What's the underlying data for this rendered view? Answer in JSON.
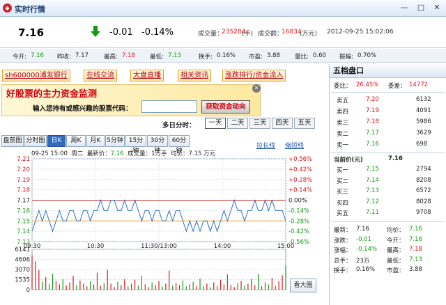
{
  "window": {
    "title": "实时行情",
    "minimize": "—",
    "maximize": "□",
    "close": "✕"
  },
  "quote": {
    "price": "7.16",
    "change": "-0.01",
    "change_pct": "-0.14%",
    "volume_label": "成交量：",
    "volume": "235284",
    "volume_unit": "(手)",
    "amount_label": "成交额：",
    "amount": "16834",
    "amount_unit": "(万元)",
    "datetime": "2012-09-25 15:02:06"
  },
  "stats": [
    {
      "label": "今开:",
      "value": "7.16",
      "color": "green"
    },
    {
      "label": "昨收:",
      "value": "7.17",
      "color": "black"
    },
    {
      "label": "最高:",
      "value": "7.18",
      "color": "red"
    },
    {
      "label": "最低:",
      "value": "7.13",
      "color": "green"
    },
    {
      "label": "换手:",
      "value": "0.16%",
      "color": "black"
    },
    {
      "label": "市盈:",
      "value": "3.88",
      "color": "black"
    },
    {
      "label": "量比:",
      "value": "0.60",
      "color": "black"
    },
    {
      "label": "振幅:",
      "value": "0.70%",
      "color": "black"
    }
  ],
  "links": [
    "sh600000浦发银行",
    "在线交流",
    "大盘直播",
    "相关资讯",
    "涨跌排行/资金流入"
  ],
  "banner": {
    "title": "好股票的主力资金监测",
    "input_label": "输入您持有或感兴趣的股票代码：",
    "button": "获取资金动向",
    "input_value": ""
  },
  "multiday": {
    "label": "多日分时：",
    "days": [
      "一天",
      "二天",
      "三天",
      "四天",
      "五天"
    ]
  },
  "chart_links": {
    "long": "拉长线",
    "short": "缩短线"
  },
  "tabs": [
    "盘前图",
    "分时图",
    "日K",
    "周K",
    "月K",
    "5分钟",
    "15分钟",
    "30分钟",
    "60分钟"
  ],
  "infoline": {
    "time": "09-25 15:00",
    "weekday": "周二",
    "latest_label": "最新价：",
    "latest": "7.16",
    "vol_label": "成交量：",
    "vol": "1",
    "vol_unit": "万手",
    "avg_label": "均价：",
    "avg": "7.15",
    "extra": "万元"
  },
  "bigchart_button": "看大图",
  "orderbook": {
    "title": "五档盘口",
    "weibi_label": "委比：",
    "weibi": "26.45%",
    "weicha_label": "委差：",
    "weicha": "14772",
    "sells": [
      {
        "label": "卖五",
        "price": "7.20",
        "vol": "6132"
      },
      {
        "label": "卖四",
        "price": "7.19",
        "vol": "4091"
      },
      {
        "label": "卖三",
        "price": "7.18",
        "vol": "5986"
      },
      {
        "label": "卖二",
        "price": "7.17",
        "vol": "3629"
      },
      {
        "label": "卖一",
        "price": "7.16",
        "vol": "698"
      }
    ],
    "current_label": "当前价(元)",
    "current": "7.16",
    "buys": [
      {
        "label": "买一",
        "price": "7.15",
        "vol": "2794"
      },
      {
        "label": "买二",
        "price": "7.14",
        "vol": "8208"
      },
      {
        "label": "买三",
        "price": "7.13",
        "vol": "6572"
      },
      {
        "label": "买四",
        "price": "7.12",
        "vol": "8028"
      },
      {
        "label": "买五",
        "price": "7.11",
        "vol": "9708"
      }
    ],
    "extra": [
      [
        {
          "l": "最新：",
          "v": "7.16",
          "c": "black"
        },
        {
          "l": "均价：",
          "v": "7.16",
          "c": "green"
        }
      ],
      [
        {
          "l": "涨跌：",
          "v": "-0.01",
          "c": "green"
        },
        {
          "l": "今开：",
          "v": "7.16",
          "c": "green"
        }
      ],
      [
        {
          "l": "涨幅：",
          "v": "-0.14%",
          "c": "green"
        },
        {
          "l": "最高：",
          "v": "7.18",
          "c": "red"
        }
      ],
      [
        {
          "l": "总手：",
          "v": "23万",
          "c": "black"
        },
        {
          "l": "最低：",
          "v": "7.13",
          "c": "green"
        }
      ],
      [
        {
          "l": "换手：",
          "v": "0.16%",
          "c": "black"
        },
        {
          "l": "市盈：",
          "v": "3.88",
          "c": "black"
        }
      ]
    ]
  },
  "chart_data": {
    "type": "line",
    "title": "",
    "x_ticks": [
      "09:30",
      "10:30",
      "11:30/13:00",
      "14:00",
      "15:00"
    ],
    "y_ticks": [
      "7.21",
      "7.20",
      "7.19",
      "7.18",
      "7.17",
      "7.16",
      "7.15",
      "7.14",
      "7.13"
    ],
    "y_pct_ticks": [
      "+0.56%",
      "+0.42%",
      "+0.28%",
      "+0.14%",
      "0.00%",
      "-0.14%",
      "-0.28%",
      "-0.42%",
      "-0.56%"
    ],
    "ylim": [
      7.13,
      7.21
    ],
    "prev_close": 7.17,
    "price": [
      7.14,
      7.15,
      7.16,
      7.15,
      7.16,
      7.15,
      7.14,
      7.15,
      7.16,
      7.15,
      7.15,
      7.16,
      7.16,
      7.15,
      7.15,
      7.16,
      7.16,
      7.15,
      7.16,
      7.16,
      7.17,
      7.16,
      7.16,
      7.17,
      7.17,
      7.16,
      7.16,
      7.17,
      7.16,
      7.16,
      7.17,
      7.16,
      7.15,
      7.16,
      7.16,
      7.15,
      7.16,
      7.16,
      7.15,
      7.15,
      7.16,
      7.15,
      7.16,
      7.16,
      7.15,
      7.14,
      7.15,
      7.14,
      7.15,
      7.14,
      7.15,
      7.15,
      7.14,
      7.15,
      7.14,
      7.15,
      7.16,
      7.15,
      7.16,
      7.17,
      7.16,
      7.16,
      7.15,
      7.16,
      7.16,
      7.17,
      7.16,
      7.16,
      7.17,
      7.16,
      7.17,
      7.16,
      7.16,
      7.16,
      7.15
    ],
    "avg": [
      7.15,
      7.15,
      7.15,
      7.15,
      7.15,
      7.15,
      7.15,
      7.15,
      7.15,
      7.15,
      7.15,
      7.15,
      7.15,
      7.15,
      7.15,
      7.15,
      7.15,
      7.15,
      7.15,
      7.15,
      7.15,
      7.15,
      7.15,
      7.15,
      7.15,
      7.15,
      7.15,
      7.15,
      7.15,
      7.15,
      7.15,
      7.15,
      7.15,
      7.15,
      7.15,
      7.15,
      7.15,
      7.15,
      7.15,
      7.15,
      7.15,
      7.15,
      7.15,
      7.15,
      7.15,
      7.15,
      7.15,
      7.15,
      7.15,
      7.15,
      7.15,
      7.15,
      7.15,
      7.15,
      7.15,
      7.15,
      7.15,
      7.15,
      7.15,
      7.15,
      7.15,
      7.15,
      7.15,
      7.15,
      7.15,
      7.15,
      7.15,
      7.15,
      7.15,
      7.15,
      7.15,
      7.15,
      7.15,
      7.15,
      7.15
    ],
    "volume_ticks": [
      "6141",
      "4606",
      "3070",
      "1535",
      "0"
    ],
    "volume_ylim": [
      0,
      6141
    ],
    "volume": [
      5200,
      4300,
      3000,
      1200,
      1900,
      900,
      2400,
      1300,
      800,
      1600,
      600,
      1100,
      2100,
      700,
      1400,
      900,
      500,
      1300,
      800,
      2600,
      600,
      1000,
      3000,
      900,
      400,
      1200,
      700,
      1600,
      500,
      900,
      1500,
      600,
      2100,
      800,
      400,
      1100,
      700,
      1300,
      500,
      900,
      2900,
      600,
      1000,
      700,
      1400,
      500,
      800,
      1200,
      600,
      1700,
      500,
      900,
      400,
      1100,
      600,
      1500,
      800,
      2300,
      700,
      400,
      1000,
      1300,
      600,
      900,
      1600,
      700,
      2400,
      500,
      1100,
      800,
      1800,
      600,
      1300,
      2200,
      3600
    ]
  }
}
